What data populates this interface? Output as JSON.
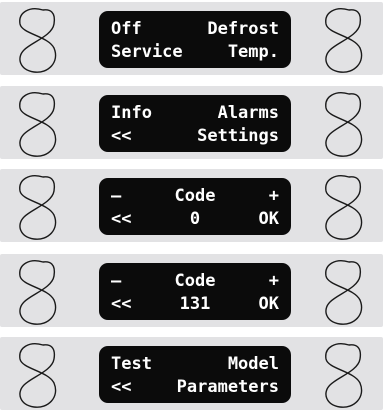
{
  "panels": [
    {
      "row1": {
        "left": "Off",
        "right": "Defrost"
      },
      "row2": {
        "left": "Service",
        "right": "Temp."
      }
    },
    {
      "row1": {
        "left": "Info",
        "right": "Alarms"
      },
      "row2": {
        "left": "<<",
        "right": "Settings"
      }
    },
    {
      "row1": {
        "left": "–",
        "center": "Code",
        "right": "+"
      },
      "row2": {
        "left": "<<",
        "center": "0",
        "right": "OK"
      }
    },
    {
      "row1": {
        "left": "–",
        "center": "Code",
        "right": "+"
      },
      "row2": {
        "left": "<<",
        "center": "131",
        "right": "OK"
      }
    },
    {
      "row1": {
        "left": "Test",
        "right": "Model"
      },
      "row2": {
        "left": "<<",
        "right": "Parameters"
      }
    }
  ],
  "icons": {
    "knob": "figure-eight-knob-icon"
  },
  "colors": {
    "panel_bg": "#e2e2e4",
    "lcd_bg": "#0b0b0b",
    "lcd_text": "#ffffff",
    "knob_stroke": "#1a1a1a"
  }
}
